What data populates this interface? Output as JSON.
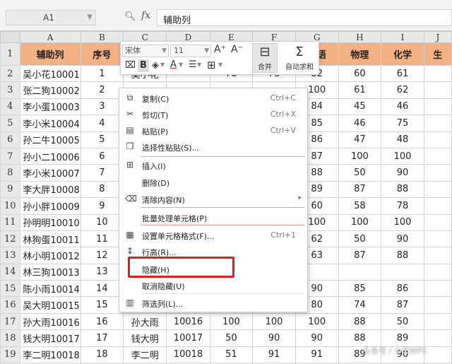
{
  "formula_bar": {
    "name_box": "A1",
    "fx_label": "fx",
    "content": "辅助列"
  },
  "sheet": {
    "columns": [
      "A",
      "B",
      "C",
      "D",
      "E",
      "F",
      "G",
      "H",
      "I",
      "J"
    ],
    "header_row": [
      "辅助列",
      "序号",
      "",
      "",
      "",
      "",
      "英语",
      "物理",
      "化学",
      "生"
    ],
    "rows": [
      {
        "n": "2",
        "a": "吴小花10001",
        "b": "1",
        "c": "吴小花",
        "d": "",
        "e": "78",
        "f": "73",
        "g": "82",
        "h": "60",
        "i": "61"
      },
      {
        "n": "3",
        "a": "张二狗10002",
        "b": "2",
        "c": "",
        "d": "",
        "e": "",
        "f": "",
        "g": "100",
        "h": "61",
        "i": "62"
      },
      {
        "n": "4",
        "a": "李小蛋10003",
        "b": "3",
        "c": "",
        "d": "",
        "e": "",
        "f": "",
        "g": "84",
        "h": "45",
        "i": "46"
      },
      {
        "n": "5",
        "a": "李小米10004",
        "b": "4",
        "c": "",
        "d": "",
        "e": "",
        "f": "",
        "g": "85",
        "h": "46",
        "i": "75"
      },
      {
        "n": "6",
        "a": "孙二牛10005",
        "b": "5",
        "c": "",
        "d": "",
        "e": "",
        "f": "",
        "g": "86",
        "h": "47",
        "i": "48"
      },
      {
        "n": "7",
        "a": "孙小二10006",
        "b": "6",
        "c": "",
        "d": "",
        "e": "",
        "f": "",
        "g": "87",
        "h": "100",
        "i": "100"
      },
      {
        "n": "8",
        "a": "李小米10007",
        "b": "7",
        "c": "",
        "d": "",
        "e": "",
        "f": "",
        "g": "88",
        "h": "50",
        "i": "90"
      },
      {
        "n": "9",
        "a": "李大胖10008",
        "b": "8",
        "c": "",
        "d": "",
        "e": "",
        "f": "",
        "g": "89",
        "h": "87",
        "i": "88"
      },
      {
        "n": "10",
        "a": "孙小胖10009",
        "b": "9",
        "c": "",
        "d": "",
        "e": "",
        "f": "",
        "g": "60",
        "h": "58",
        "i": "78"
      },
      {
        "n": "11",
        "a": "孙明明10010",
        "b": "10",
        "c": "",
        "d": "",
        "e": "",
        "f": "",
        "g": "100",
        "h": "100",
        "i": "100"
      },
      {
        "n": "12",
        "a": "林狗蛋10011",
        "b": "11",
        "c": "",
        "d": "",
        "e": "",
        "f": "",
        "g": "62",
        "h": "50",
        "i": "90"
      },
      {
        "n": "13",
        "a": "林小明10012",
        "b": "12",
        "c": "",
        "d": "",
        "e": "",
        "f": "",
        "g": "63",
        "h": "87",
        "i": "88"
      },
      {
        "n": "14",
        "a": "林三狗10013",
        "b": "13",
        "c": "",
        "d": "",
        "e": "",
        "f": "",
        "g": "",
        "h": "",
        "i": ""
      },
      {
        "n": "15",
        "a": "陈小雨10014",
        "b": "14",
        "c": "",
        "d": "",
        "e": "",
        "f": "",
        "g": "90",
        "h": "85",
        "i": "86"
      },
      {
        "n": "16",
        "a": "吴大明10015",
        "b": "15",
        "c": "",
        "d": "",
        "e": "",
        "f": "",
        "g": "80",
        "h": "74",
        "i": "87"
      },
      {
        "n": "17",
        "a": "孙大雨10016",
        "b": "16",
        "c": "孙大雨",
        "d": "10016",
        "e": "100",
        "f": "100",
        "g": "100",
        "h": "88",
        "i": "50"
      },
      {
        "n": "18",
        "a": "钱大明10017",
        "b": "17",
        "c": "钱大明",
        "d": "10017",
        "e": "50",
        "f": "90",
        "g": "90",
        "h": "88",
        "i": "89"
      },
      {
        "n": "19",
        "a": "李二明10018",
        "b": "18",
        "c": "李二明",
        "d": "10018",
        "e": "51",
        "f": "91",
        "g": "91",
        "h": "89",
        "i": "90"
      },
      {
        "n": "20",
        "a": "陈小鱼10019",
        "b": "19",
        "c": "陈小鱼",
        "d": "10019",
        "e": "52",
        "f": "92",
        "g": "92",
        "h": "90",
        "i": "91"
      }
    ]
  },
  "mini_toolbar": {
    "font_name": "宋体",
    "font_size": "11",
    "grow_font": "A⁺",
    "shrink_font": "A⁻",
    "bold": "B",
    "merge_label": "合并",
    "autosum_label": "自动求和"
  },
  "context_menu": {
    "items": [
      {
        "label": "复制(C)",
        "shortcut": "Ctrl+C",
        "icon": "copy-icon",
        "glyph": "⧉"
      },
      {
        "label": "剪切(T)",
        "shortcut": "Ctrl+X",
        "icon": "scissors-icon",
        "glyph": "✂"
      },
      {
        "label": "粘贴(P)",
        "shortcut": "Ctrl+V",
        "icon": "paste-icon",
        "glyph": "▤"
      },
      {
        "label": "选择性粘贴(S)...",
        "shortcut": "",
        "icon": "paste-special-icon",
        "glyph": "❐"
      },
      {
        "label": "插入(I)",
        "shortcut": "",
        "icon": "insert-icon",
        "glyph": "⊞"
      },
      {
        "label": "删除(D)",
        "shortcut": "",
        "icon": "",
        "glyph": ""
      },
      {
        "label": "清除内容(N)",
        "shortcut": "",
        "icon": "eraser-icon",
        "glyph": "⌫"
      },
      {
        "label": "批量处理单元格(P)",
        "shortcut": "",
        "icon": "",
        "glyph": ""
      },
      {
        "label": "设置单元格格式(F)...",
        "shortcut": "Ctrl+1",
        "icon": "format-cells-icon",
        "glyph": "▦"
      },
      {
        "label": "行高(R)...",
        "shortcut": "",
        "icon": "row-height-icon",
        "glyph": "↕"
      },
      {
        "label": "隐藏(H)",
        "shortcut": "",
        "icon": "",
        "glyph": ""
      },
      {
        "label": "取消隐藏(U)",
        "shortcut": "",
        "icon": "",
        "glyph": ""
      },
      {
        "label": "筛选列(L)...",
        "shortcut": "",
        "icon": "filter-columns-icon",
        "glyph": "▥"
      }
    ],
    "submenu_arrow": "▸"
  },
  "colors": {
    "header_fill": "#f4b183",
    "highlight_border": "#e02020"
  }
}
